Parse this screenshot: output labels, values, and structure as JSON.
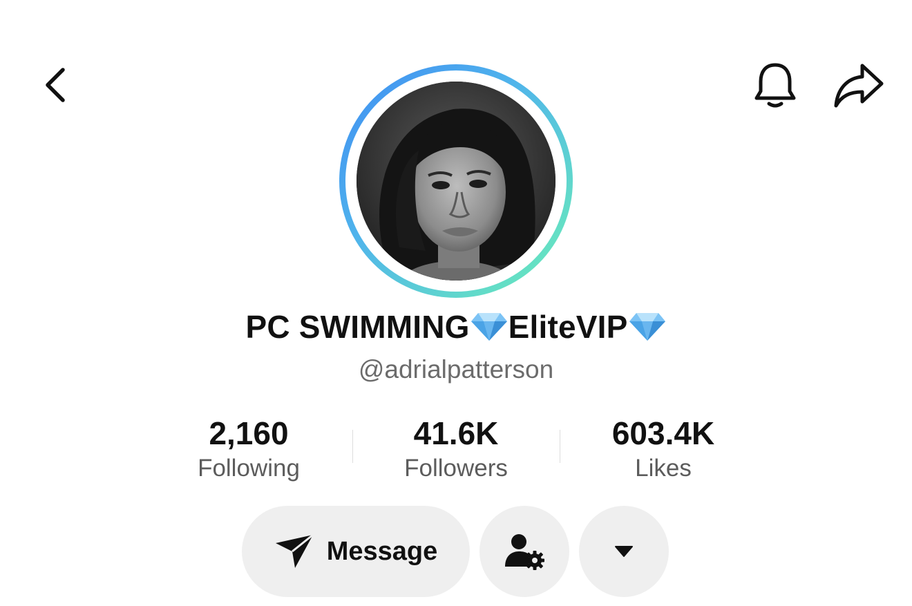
{
  "header": {
    "back_icon": "chevron-left-icon",
    "notification_icon": "bell-icon",
    "share_icon": "share-arrow-icon"
  },
  "profile": {
    "name_part1": "PC SWIMMING",
    "name_part2": "EliteVIP",
    "badge_icon": "diamond-icon",
    "username": "@adrialpatterson",
    "ring_colors": [
      "#3f8cf2",
      "#6cf0b6"
    ]
  },
  "stats": [
    {
      "value": "2,160",
      "label": "Following"
    },
    {
      "value": "41.6K",
      "label": "Followers"
    },
    {
      "value": "603.4K",
      "label": "Likes"
    }
  ],
  "actions": {
    "message_label": "Message",
    "message_icon": "send-icon",
    "friend_icon": "user-settings-icon",
    "more_icon": "caret-down-icon"
  }
}
